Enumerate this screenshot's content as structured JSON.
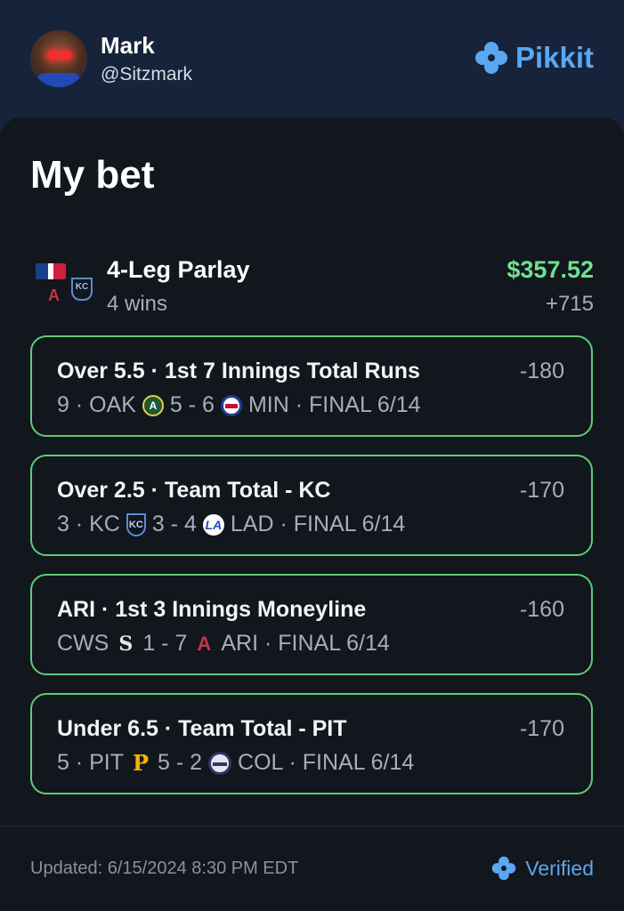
{
  "header": {
    "user_name": "Mark",
    "user_handle": "@Sitzmark",
    "brand": "Pikkit",
    "brand_color": "#5aa7f2",
    "avatar_icon": "user-avatar"
  },
  "card": {
    "title": "My bet",
    "parlay": {
      "title": "4-Leg Parlay",
      "subtitle": "4 wins",
      "payout": "$357.52",
      "odds": "+715",
      "payout_color": "#6ee28f"
    },
    "legs": [
      {
        "title": "Over 5.5 · 1st 7 Innings Total Runs",
        "odds": "-180",
        "prefix": "9 · OAK",
        "logo1": "oakland-athletics-icon",
        "score": "5 - 6",
        "logo2": "minnesota-twins-icon",
        "suffix": "MIN · FINAL 6/14"
      },
      {
        "title": "Over 2.5 · Team Total - KC",
        "odds": "-170",
        "prefix": "3 · KC",
        "logo1": "kansas-city-royals-icon",
        "score": "3 - 4",
        "logo2": "los-angeles-dodgers-icon",
        "suffix": "LAD · FINAL 6/14"
      },
      {
        "title": "ARI · 1st 3 Innings Moneyline",
        "odds": "-160",
        "prefix": "CWS",
        "logo1": "chicago-white-sox-icon",
        "score": "1 - 7",
        "logo2": "arizona-diamondbacks-icon",
        "suffix": "ARI · FINAL 6/14"
      },
      {
        "title": "Under 6.5 · Team Total - PIT",
        "odds": "-170",
        "prefix": "5 · PIT",
        "logo1": "pittsburgh-pirates-icon",
        "score": "5 - 2",
        "logo2": "colorado-rockies-icon",
        "suffix": "COL · FINAL 6/14"
      }
    ],
    "leg_border_color": "#5ecb78"
  },
  "footer": {
    "updated": "Updated: 6/15/2024 8:30 PM EDT",
    "verified": "Verified"
  }
}
